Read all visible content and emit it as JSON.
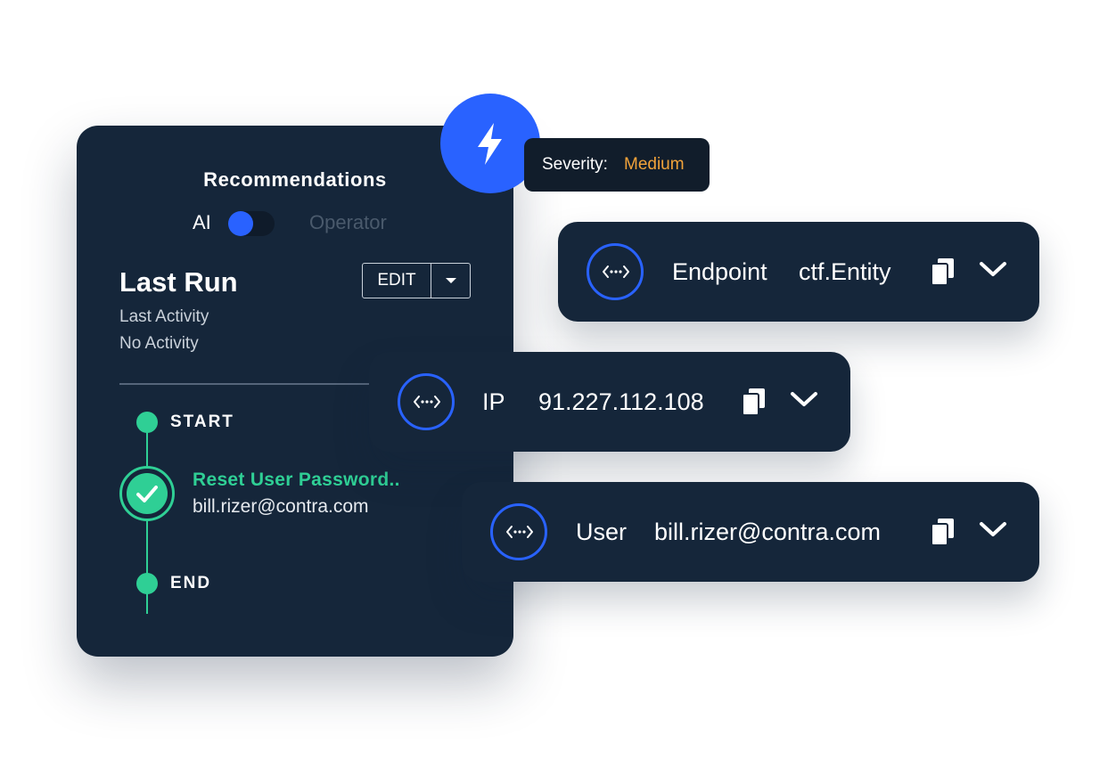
{
  "recommendations": {
    "title": "Recommendations",
    "toggle": {
      "left_label": "AI",
      "right_label": "Operator",
      "selected": "AI"
    }
  },
  "last_run": {
    "title": "Last Run",
    "edit_label": "EDIT",
    "activity_label": "Last Activity",
    "activity_value": "No Activity"
  },
  "timeline": {
    "start_label": "START",
    "step_title": "Reset User Password..",
    "step_subtitle": "bill.rizer@contra.com",
    "end_label": "END"
  },
  "severity": {
    "label": "Severity:",
    "value": "Medium"
  },
  "entities": [
    {
      "type": "Endpoint",
      "value": "ctf.Entity"
    },
    {
      "type": "IP",
      "value": "91.227.112.108"
    },
    {
      "type": "User",
      "value": "bill.rizer@contra.com"
    }
  ],
  "icons": {
    "severity": "lightning-bolt-icon",
    "entity": "code-link-icon",
    "copy": "copy-icon",
    "expand": "chevron-down-icon",
    "step_done": "checkmark-icon"
  },
  "colors": {
    "panel": "#15263a",
    "accent_blue": "#2962ff",
    "success_green": "#2fcf95",
    "severity_medium": "#f2a33a"
  }
}
